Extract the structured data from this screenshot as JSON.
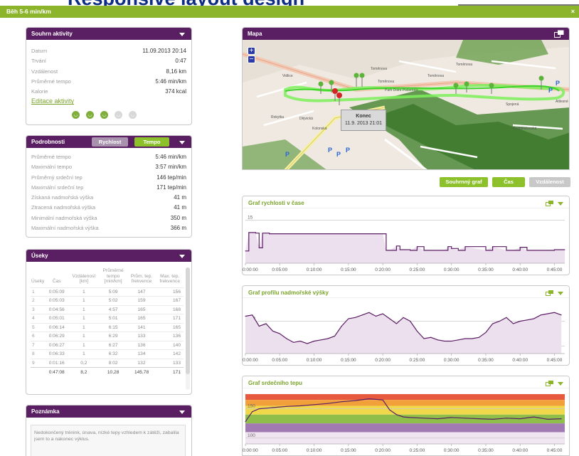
{
  "hero": {
    "text": "Responsive layout design"
  },
  "window": {
    "title": "Běh 5-6 min/km",
    "close": "×"
  },
  "summary": {
    "title": "Souhrn aktivity",
    "rows": [
      {
        "label": "Datum",
        "value": "11.09.2013 20:14"
      },
      {
        "label": "Trvání",
        "value": "0:47"
      },
      {
        "label": "Vzdálenost",
        "value": "8,16 km"
      },
      {
        "label": "Průměrné tempo",
        "value": "5:46 min/km"
      },
      {
        "label": "Kalorie",
        "value": "374 kcal"
      }
    ],
    "edit_link": "Editace aktivity",
    "feel_rating": {
      "selected": 3,
      "max": 5
    }
  },
  "details": {
    "title": "Podrobnosti",
    "tab_speed": "Rychlost",
    "tab_pace": "Tempo",
    "rows": [
      {
        "label": "Průměrné tempo",
        "value": "5:46 min/km"
      },
      {
        "label": "Maximální tempo",
        "value": "3:57 min/km"
      },
      {
        "label": "Průměrný srdeční tep",
        "value": "146 tep/min"
      },
      {
        "label": "Maximální srdeční tep",
        "value": "171 tep/min"
      },
      {
        "label": "Získaná nadmořská výška",
        "value": "41 m"
      },
      {
        "label": "Ztracená nadmořská výška",
        "value": "41 m"
      },
      {
        "label": "Minimální nadmořská výška",
        "value": "350 m"
      },
      {
        "label": "Maximální nadmořská výška",
        "value": "366 m"
      }
    ]
  },
  "sections": {
    "title": "Úseky",
    "headers": [
      [
        "Úseky"
      ],
      [
        "Čas"
      ],
      [
        "Vzdálenost",
        "[km]"
      ],
      [
        "Průměrné",
        "tempo",
        "[min/km]"
      ],
      [
        "Prům. tep.",
        "frekvence"
      ],
      [
        "Max. tep.",
        "frekvence"
      ]
    ],
    "rows": [
      [
        "1",
        "0:05:09",
        "1",
        "5:09",
        "147",
        "156"
      ],
      [
        "2",
        "0:05:03",
        "1",
        "5:02",
        "159",
        "167"
      ],
      [
        "3",
        "0:04:56",
        "1",
        "4:57",
        "165",
        "168"
      ],
      [
        "4",
        "0:05:01",
        "1",
        "5:01",
        "165",
        "171"
      ],
      [
        "5",
        "0:06:14",
        "1",
        "6:15",
        "141",
        "165"
      ],
      [
        "6",
        "0:06:29",
        "1",
        "6:29",
        "133",
        "136"
      ],
      [
        "7",
        "0:06:27",
        "1",
        "6:27",
        "136",
        "140"
      ],
      [
        "8",
        "0:06:33",
        "1",
        "6:32",
        "134",
        "142"
      ],
      [
        "9",
        "0:01:16",
        "0,2",
        "8:02",
        "132",
        "133"
      ]
    ],
    "totals": [
      "",
      "0:47:08",
      "8,2",
      "10,28",
      "145,78",
      "171"
    ]
  },
  "note": {
    "title": "Poznámka",
    "text": "Nedokončený trénink, únava, nízké tepy vzhledem k zátěži, zabalila jsem to a nakonec výklus."
  },
  "map": {
    "title": "Mapa",
    "zoom_in": "+",
    "zoom_out": "−",
    "end_label": "Konec",
    "end_time": "11.9. 2013 21:01",
    "streets": [
      "Toměnova",
      "Toměnova",
      "Toměnova",
      "Toměnova",
      "Dějvická",
      "Rokytka",
      "Park Dolní Počernice",
      "Vidlice",
      "Kolonská",
      "Altlesné",
      "Spojená",
      "Podbělohorská"
    ]
  },
  "graph_buttons": {
    "summary": "Souhrnný graf",
    "time": "Čas",
    "distance": "Vzdálenost"
  },
  "colors": {
    "purple": "#5a1e62",
    "green": "#8cb52b",
    "chart_line": "#5b1d63",
    "chart_fill": "#ece0ef"
  },
  "x_ticks": [
    "0:00:00",
    "0:05:00",
    "0:10:00",
    "0:15:00",
    "0:20:00",
    "0:25:00",
    "0:30:00",
    "0:35:00",
    "0:40:00",
    "0:45:00"
  ],
  "chart_data": [
    {
      "type": "line",
      "title": "Graf rychlosti v čase",
      "xlabel": "",
      "ylabel": "",
      "y_ticks": [
        "15",
        "1"
      ],
      "ylim": [
        8,
        16
      ],
      "x": [
        0,
        0.5,
        1,
        1.5,
        2,
        2.5,
        3,
        3.5,
        20,
        20.5,
        21,
        22,
        22.5,
        24,
        25,
        26,
        29,
        29.5,
        30,
        31,
        32,
        35,
        36,
        38,
        39,
        40,
        41,
        42,
        44,
        45,
        46.5
      ],
      "y": [
        10,
        13,
        13,
        12.9,
        10.5,
        12.9,
        12.9,
        12.8,
        12.8,
        10.1,
        10.1,
        10.8,
        10.2,
        10.1,
        10.7,
        10.1,
        10.1,
        10.7,
        10.4,
        10.1,
        10.7,
        10.1,
        10.7,
        10.1,
        10.1,
        10.6,
        10.1,
        10.1,
        10.1,
        10.2,
        10.2
      ],
      "grid": true
    },
    {
      "type": "area",
      "title": "Graf profilu nadmořské výšky",
      "xlabel": "",
      "ylabel": "",
      "y_ticks": [
        "360",
        "350"
      ],
      "ylim": [
        347,
        367
      ],
      "x": [
        0,
        1,
        2,
        3,
        4,
        5,
        6,
        7,
        8,
        9,
        10,
        11,
        12,
        13,
        14,
        15,
        16,
        17,
        18,
        19,
        20,
        21,
        22,
        23,
        24,
        25,
        26,
        27,
        28,
        29,
        30,
        31,
        32,
        33,
        34,
        35,
        36,
        37,
        38,
        39,
        40,
        41,
        42,
        43,
        44,
        45,
        46
      ],
      "y": [
        362,
        362.5,
        358,
        359,
        356,
        355,
        353,
        351.5,
        352,
        351,
        352,
        352.5,
        353,
        354,
        358,
        361,
        361.5,
        362.5,
        363.5,
        362,
        363,
        361,
        359,
        361.5,
        360,
        356,
        353,
        353.5,
        352.5,
        352,
        352,
        352.5,
        353,
        353,
        353.5,
        355.5,
        359,
        360,
        361.5,
        359,
        360,
        360.5,
        361,
        362.5,
        363,
        363.5,
        362.5
      ],
      "grid": true
    },
    {
      "type": "area",
      "title": "Graf srdečního tepu",
      "xlabel": "",
      "ylabel": "",
      "y_ticks": [
        "150",
        "100"
      ],
      "ylim": [
        90,
        175
      ],
      "zones": [
        {
          "from": 165,
          "to": 175,
          "color": "#e85a40"
        },
        {
          "from": 155,
          "to": 165,
          "color": "#f2a03a"
        },
        {
          "from": 140,
          "to": 155,
          "color": "#f0d84a"
        },
        {
          "from": 125,
          "to": 140,
          "color": "#8fbf4a"
        },
        {
          "from": 110,
          "to": 125,
          "color": "#a07ab0"
        },
        {
          "from": 90,
          "to": 110,
          "color": "#f0e6f2"
        }
      ],
      "x": [
        0,
        1,
        2,
        3,
        4,
        5,
        6,
        8,
        10,
        12,
        14,
        16,
        18,
        19,
        20,
        21,
        22,
        23,
        24,
        26,
        28,
        30,
        32,
        34,
        36,
        38,
        40,
        42,
        44,
        46
      ],
      "y": [
        128,
        145,
        150,
        151,
        152,
        153,
        154,
        155,
        157,
        159,
        162,
        164,
        167,
        166,
        165,
        148,
        140,
        136,
        135,
        134,
        133,
        135,
        134,
        133,
        132,
        134,
        133,
        136,
        132,
        133
      ],
      "grid": true
    }
  ]
}
